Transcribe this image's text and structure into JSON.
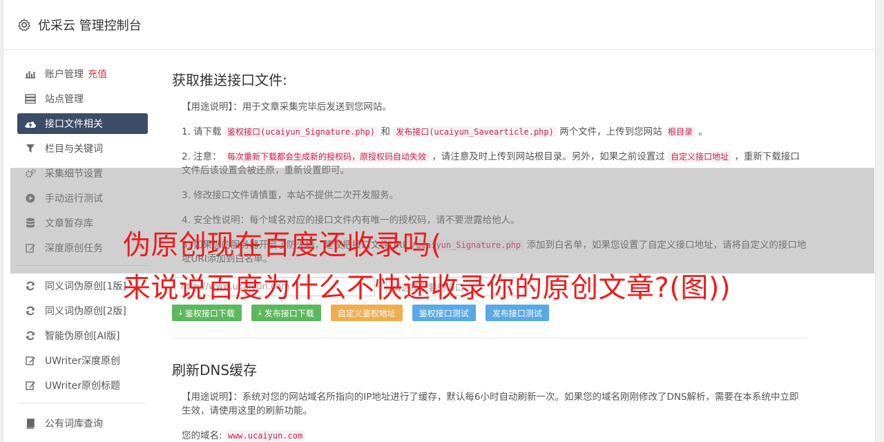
{
  "header": {
    "title": "优采云 管理控制台"
  },
  "sidebar": {
    "items": [
      {
        "label": "账户管理",
        "extra": "充值",
        "icon": "bar-chart-icon"
      },
      {
        "label": "站点管理",
        "icon": "server-icon"
      },
      {
        "label": "接口文件相关",
        "icon": "cloud-upload-icon",
        "active": true
      },
      {
        "label": "栏目与关键词",
        "icon": "filter-icon"
      },
      {
        "label": "采集细节设置",
        "icon": "cogs-icon"
      },
      {
        "label": "手动运行测试",
        "icon": "play-icon"
      },
      {
        "label": "文章暂存库",
        "icon": "database-icon"
      },
      {
        "label": "深度原创任务",
        "icon": "edit-icon"
      }
    ],
    "items2": [
      {
        "label": "同义词伪原创[1版]",
        "icon": "refresh-icon"
      },
      {
        "label": "同义词伪原创[2版]",
        "icon": "refresh-icon"
      },
      {
        "label": "智能伪原创[AI版]",
        "icon": "refresh-icon"
      },
      {
        "label": "UWriter深度原创",
        "icon": "edit-icon"
      },
      {
        "label": "UWriter原创标题",
        "icon": "edit-icon"
      }
    ],
    "items3": [
      {
        "label": "公有词库查询",
        "icon": "book-icon"
      }
    ]
  },
  "section1": {
    "title": "获取推送接口文件:",
    "usage": "【用途说明】：用于文章采集完毕后发送到您网站。",
    "step1": {
      "a": "1. 请下载",
      "c1": "鉴权接口(ucaiyun_Signature.php)",
      "b": "和",
      "c2": "发布接口(ucaiyun_Savearticle.php)",
      "d": "两个文件，上传到您网站",
      "c3": "根目录",
      "e": "。"
    },
    "step2": {
      "a": "2. 注意：",
      "c1": "每次重新下载都会生成新的授权码，原授权码自动失效",
      "b": "，请注意及时上传到网站根目录。另外，如果之前设置过",
      "c2": "自定义接口地址",
      "d": "，重新下载接口文件后该设置会被还原，重新设置即可。"
    },
    "step3": "3. 修改接口文件请慎重，本站不提供二次开发服务。",
    "step4": "4. 安全性说明：每个域名对应的接口文件内有唯一的授权码，请不要泄露给他人。",
    "step5": {
      "a": "5. 如果您的服务器开启了防火墙，建议把接口文件URI",
      "c1": "/ucaiyun_Signature.php",
      "b": "添加到白名单，如果您设置了自定义接口地址，请将自定义的接口地址URI添加到白名单。"
    },
    "input1": "http://www.ucaiyun.com",
    "input2": "请选择您要的接口",
    "buttons": [
      "鉴权接口下载",
      "发布接口下载",
      "自定义鉴权地址",
      "鉴权接口测试",
      "发布接口测试"
    ]
  },
  "section2": {
    "title": "刷新DNS缓存",
    "usage": "【用途说明】：系统对您的网站域名所指向的IP地址进行了缓存，默认每6小时自动刷新一次。如果您的域名刚刚修改了DNS解析，需要在本系统中立即生效，请使用这里的刷新功能。",
    "domain_label": "您的域名:",
    "domain_value": "www.ucaiyun.com"
  },
  "watermark": {
    "line1": "伪原创现在百度还收录吗(",
    "line2": "来说说百度为什么不快速收录你的原创文章?(图))"
  }
}
